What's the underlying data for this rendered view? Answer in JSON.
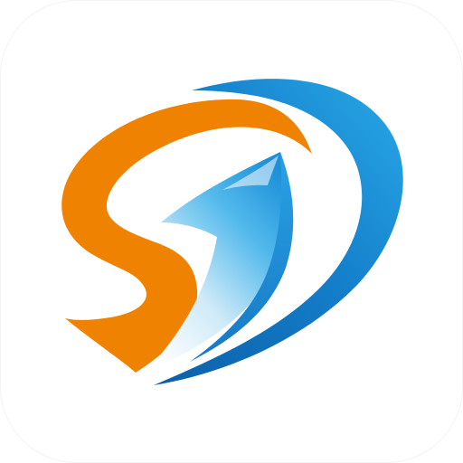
{
  "icon": {
    "name": "sd-swoosh-logo-icon",
    "background": "#ffffff",
    "colors": {
      "orange": "#EF8200",
      "blue_dark": "#0A66B2",
      "blue_mid": "#1A8ED8",
      "blue_light": "#2AA9E8",
      "blue_pale": "#D9F0FA"
    }
  }
}
